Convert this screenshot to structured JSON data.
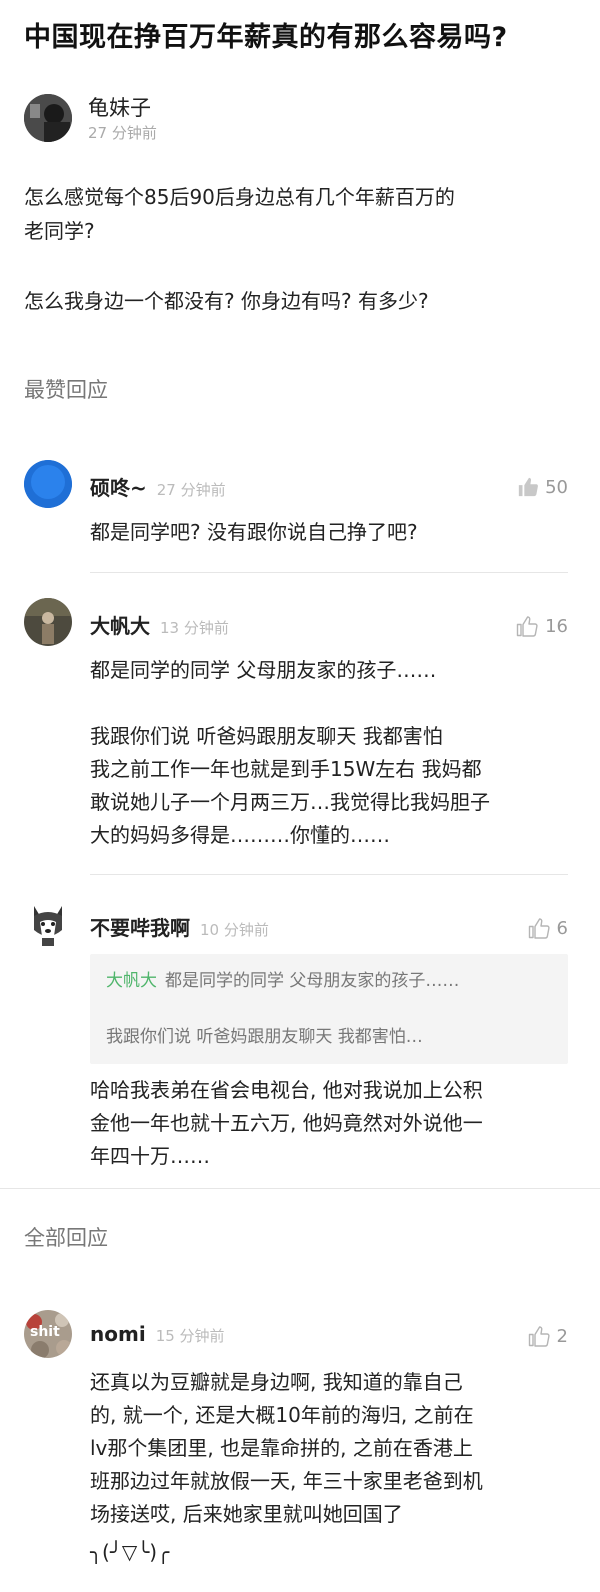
{
  "question": {
    "title": "中国现在挣百万年薪真的有那么容易吗?",
    "author": "龟妹子",
    "time": "27 分钟前",
    "body_line1": "怎么感觉每个85后90后身边总有几个年薪百万的",
    "body_line2": "老同学?",
    "body_line3": "怎么我身边一个都没有? 你身边有吗? 有多少?"
  },
  "sections": {
    "top": "最赞回应",
    "all": "全部回应"
  },
  "replies": [
    {
      "name": "硕咚~",
      "time": "27 分钟前",
      "likes": "50",
      "lines": [
        "都是同学吧? 没有跟你说自己挣了吧?"
      ]
    },
    {
      "name": "大帆大",
      "time": "13 分钟前",
      "likes": "16",
      "lines": [
        "都是同学的同学 父母朋友家的孩子……",
        "我跟你们说 听爸妈跟朋友聊天 我都害怕",
        "我之前工作一年也就是到手15W左右 我妈都",
        "敢说她儿子一个月两三万…我觉得比我妈胆子",
        "大的妈妈多得是………你懂的……"
      ]
    },
    {
      "name": "不要哔我啊",
      "time": "10 分钟前",
      "likes": "6",
      "quote_name": "大帆大",
      "quote_line1": "都是同学的同学 父母朋友家的孩子……",
      "quote_line2": "我跟你们说 听爸妈跟朋友聊天 我都害怕…",
      "lines": [
        "哈哈我表弟在省会电视台, 他对我说加上公积",
        "金他一年也就十五六万, 他妈竟然对外说他一",
        "年四十万……"
      ]
    },
    {
      "name": "nomi",
      "time": "15 分钟前",
      "likes": "2",
      "avatar_text": "shit",
      "lines": [
        "还真以为豆瓣就是身边啊, 我知道的靠自己",
        "的, 就一个, 还是大概10年前的海归, 之前在",
        "lv那个集团里, 也是靠命拼的, 之前在香港上",
        "班那边过年就放假一天, 年三十家里老爸到机",
        "场接送哎, 后来她家里就叫她回国了",
        "╮(╯▽╰)╭"
      ]
    }
  ],
  "colors": {
    "accent_green": "#4fb56b",
    "blue_avatar": "#1f6fd6"
  }
}
